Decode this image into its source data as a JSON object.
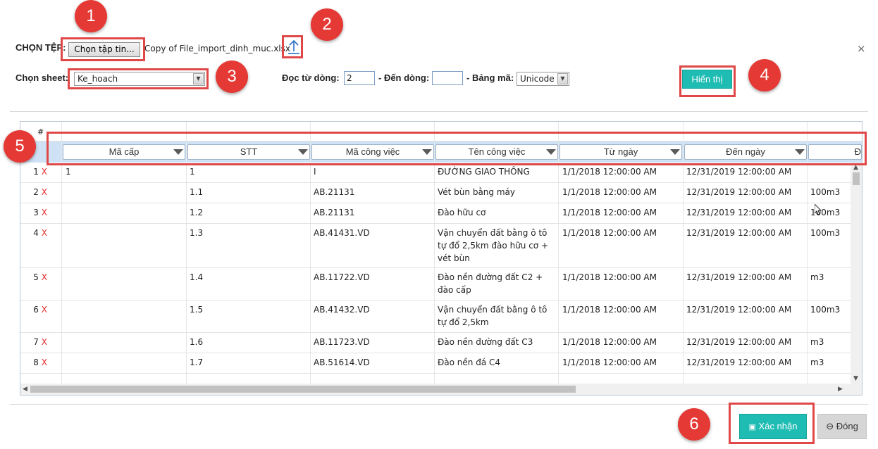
{
  "dialog": {
    "file_label": "CHỌN TỆP:",
    "choose_file_button": "Chọn tập tin...",
    "file_name": "Copy of File_import_dinh_muc.xlsx",
    "close_symbol": "×",
    "sheet_label": "Chọn sheet:",
    "sheet_value": "Ke_hoach",
    "from_row_label": "Đọc từ dòng:",
    "from_row_value": "2",
    "to_row_label": "- Đến dòng:",
    "to_row_value": "",
    "encoding_label": "- Bảng mã:",
    "encoding_value": "Unicode",
    "show_button": "Hiển thị",
    "confirm_button": "Xác nhận",
    "close_button": "Đóng"
  },
  "badges": [
    "1",
    "2",
    "3",
    "4",
    "5",
    "6"
  ],
  "grid": {
    "hash": "#",
    "columns": [
      "Mã cấp",
      "STT",
      "Mã công việc",
      "Tên công việc",
      "Từ ngày",
      "Đến ngày",
      "Đ"
    ],
    "rows": [
      {
        "n": "1",
        "x": "X",
        "ma_cap": "1",
        "stt": "1",
        "ma_cv": "I",
        "ten_cv": "ĐƯỜNG GIAO THÔNG",
        "tu": "1/1/2018 12:00:00 AM",
        "den": "12/31/2019 12:00:00 AM",
        "dv": ""
      },
      {
        "n": "2",
        "x": "X",
        "ma_cap": "",
        "stt": "1.1",
        "ma_cv": "AB.21131",
        "ten_cv": "Vét bùn bằng máy",
        "tu": "1/1/2018 12:00:00 AM",
        "den": "12/31/2019 12:00:00 AM",
        "dv": "100m3"
      },
      {
        "n": "3",
        "x": "X",
        "ma_cap": "",
        "stt": "1.2",
        "ma_cv": "AB.21131",
        "ten_cv": "Đào hữu cơ",
        "tu": "1/1/2018 12:00:00 AM",
        "den": "12/31/2019 12:00:00 AM",
        "dv": "100m3"
      },
      {
        "n": "4",
        "x": "X",
        "ma_cap": "",
        "stt": "1.3",
        "ma_cv": "AB.41431.VD",
        "ten_cv": "Vận chuyển đất bằng ô tô tự đổ 2,5km đào hữu cơ + vét bùn",
        "tu": "1/1/2018 12:00:00 AM",
        "den": "12/31/2019 12:00:00 AM",
        "dv": "100m3"
      },
      {
        "n": "5",
        "x": "X",
        "ma_cap": "",
        "stt": "1.4",
        "ma_cv": "AB.11722.VD",
        "ten_cv": "Đào nền đường đất C2 + đào cấp",
        "tu": "1/1/2018 12:00:00 AM",
        "den": "12/31/2019 12:00:00 AM",
        "dv": "m3"
      },
      {
        "n": "6",
        "x": "X",
        "ma_cap": "",
        "stt": "1.5",
        "ma_cv": "AB.41432.VD",
        "ten_cv": "Vận chuyển đất bằng ô tô tự đổ 2,5km",
        "tu": "1/1/2018 12:00:00 AM",
        "den": "12/31/2019 12:00:00 AM",
        "dv": "100m3"
      },
      {
        "n": "7",
        "x": "X",
        "ma_cap": "",
        "stt": "1.6",
        "ma_cv": "AB.11723.VD",
        "ten_cv": "Đào nền đường đất C3",
        "tu": "1/1/2018 12:00:00 AM",
        "den": "12/31/2019 12:00:00 AM",
        "dv": "m3"
      },
      {
        "n": "8",
        "x": "X",
        "ma_cap": "",
        "stt": "1.7",
        "ma_cv": "AB.51614.VD",
        "ten_cv": "Đào nền đá C4",
        "tu": "1/1/2018 12:00:00 AM",
        "den": "12/31/2019 12:00:00 AM",
        "dv": "m3"
      }
    ]
  },
  "colors": {
    "accent": "#1ebcb3",
    "annotation": "#e53935",
    "delete_mark": "#e52b2b",
    "header_strip": "#cfe2f5"
  }
}
